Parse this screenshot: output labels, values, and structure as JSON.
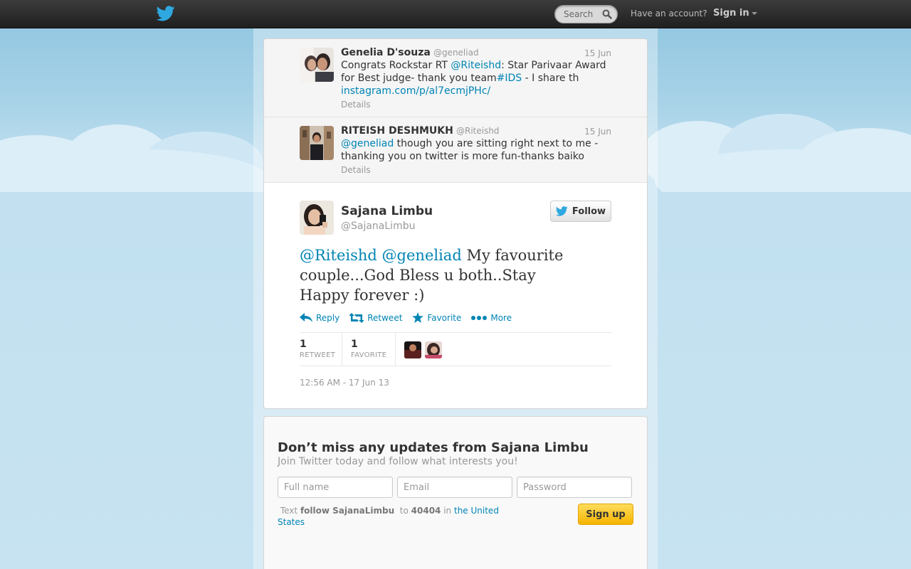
{
  "colors": {
    "link": "#0084b4",
    "topbar": "#2b2b2b",
    "twitter_blue": "#2fa8e0",
    "signup_yellow": "#f7c321"
  },
  "topbar": {
    "logo_icon": "twitter-bird-icon",
    "search_placeholder": "Search",
    "search_icon": "search-icon",
    "have_account": "Have an account?",
    "sign_in": "Sign in"
  },
  "context_tweets": [
    {
      "name": "Genelia D'souza",
      "handle": "@geneliad",
      "date": "15 Jun",
      "text_prefix": "Congrats Rockstar RT ",
      "mention": "@Riteishd",
      "text_mid": ": Star Parivaar Award for Best judge- thank you team",
      "hashtag": "#IDS",
      "text_suffix": " - I share th",
      "url": "instagram.com/p/al7ecmjPHc/",
      "details": "Details"
    },
    {
      "name": "RITEISH DESHMUKH",
      "handle": "@Riteishd",
      "date": "15 Jun",
      "mention": "@geneliad",
      "text_suffix": " though you are sitting right next to me - thanking you on twitter is more fun-thanks baiko",
      "details": "Details"
    }
  ],
  "main_tweet": {
    "name": "Sajana Limbu",
    "handle": "@SajanaLimbu",
    "follow_label": "Follow",
    "mention1": "@Riteishd",
    "mention2": "@geneliad",
    "text": " My favourite couple...God Bless u both..Stay Happy forever :)",
    "actions": {
      "reply": "Reply",
      "retweet": "Retweet",
      "favorite": "Favorite",
      "more": "More"
    },
    "stats": {
      "retweets": "1",
      "retweet_label": "RETWEET",
      "favorites": "1",
      "favorite_label": "FAVORITE"
    },
    "timestamp": "12:56 AM - 17 Jun 13"
  },
  "signup": {
    "title": "Don’t miss any updates from Sajana Limbu",
    "subtitle": "Join Twitter today and follow what interests you!",
    "fullname_placeholder": "Full name",
    "email_placeholder": "Email",
    "password_placeholder": "Password",
    "text_word": "Text",
    "follow_cmd": "follow SajanaLimbu",
    "to_word": "to",
    "shortcode": "40404",
    "in_word": "in",
    "country": "the United States",
    "button": "Sign up"
  }
}
